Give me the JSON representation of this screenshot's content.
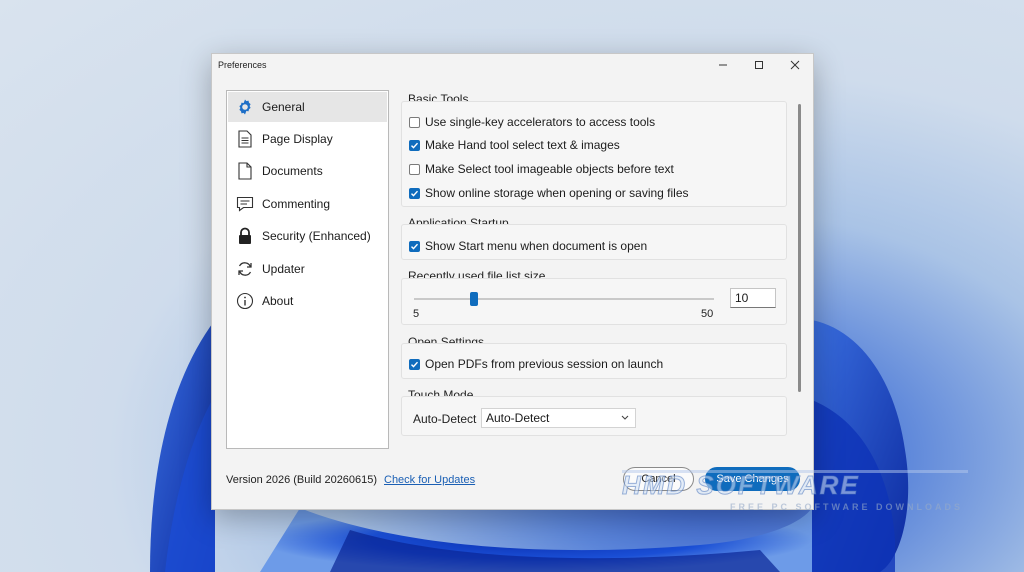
{
  "window": {
    "title": "Preferences",
    "controls": [
      "minimize-icon",
      "maximize-icon",
      "close-icon"
    ]
  },
  "sidebar": {
    "items": [
      {
        "label": "General",
        "icon": "gear-icon",
        "active": true
      },
      {
        "label": "Page Display",
        "icon": "page-icon"
      },
      {
        "label": "Documents",
        "icon": "document-icon"
      },
      {
        "label": "Commenting",
        "icon": "comment-icon"
      },
      {
        "label": "Security (Enhanced)",
        "icon": "lock-icon"
      },
      {
        "label": "Updater",
        "icon": "refresh-icon"
      },
      {
        "label": "About",
        "icon": "info-icon"
      }
    ]
  },
  "sections": {
    "basic_tools": {
      "title": "Basic Tools",
      "options": [
        {
          "label": "Use single-key accelerators to access tools",
          "checked": false
        },
        {
          "label": "Make Hand tool select text & images",
          "checked": true
        },
        {
          "label": "Make Select tool imageable objects before text",
          "checked": false
        },
        {
          "label": "Show online storage when opening or saving files",
          "checked": true
        }
      ]
    },
    "startup": {
      "title": "Application Startup",
      "options": [
        {
          "label": "Show Start menu when document is open",
          "checked": true
        }
      ]
    },
    "recent": {
      "title": "Recently used file list size",
      "min_label": "5",
      "max_label": "50",
      "value": "10",
      "slider_fraction": 0.111
    },
    "open_settings": {
      "title": "Open Settings",
      "options": [
        {
          "label": "Open PDFs from previous session on launch",
          "checked": true
        }
      ]
    },
    "touch": {
      "title": "Touch Mode",
      "label": "Auto-Detect",
      "selected": "Auto-Detect"
    }
  },
  "footer": {
    "version": "Version 2026 (Build 20260615)",
    "check_updates": "Check for Updates",
    "cancel": "Cancel",
    "save": "Save Changes"
  },
  "watermark": {
    "main": "HMD SOFTWARE",
    "sub": "FREE PC SOFTWARE DOWNLOADS"
  },
  "colors": {
    "accent": "#0f6cbd",
    "link": "#1a5fb4"
  }
}
